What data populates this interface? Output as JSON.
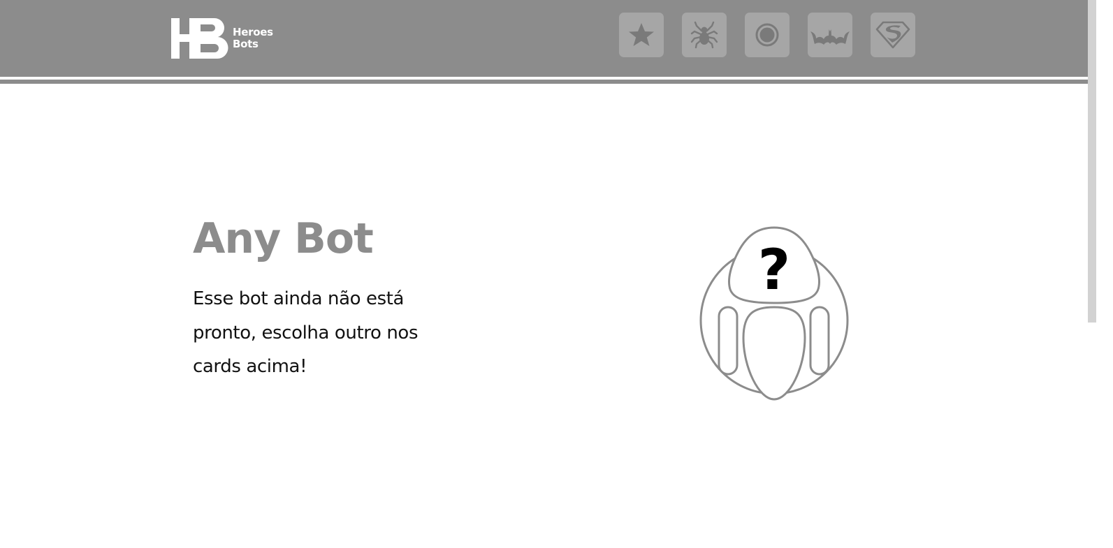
{
  "brand": {
    "logo_mark": "HB",
    "name_line1": "Heroes",
    "name_line2": "Bots"
  },
  "nav": {
    "items": [
      {
        "icon": "star-icon"
      },
      {
        "icon": "spider-icon"
      },
      {
        "icon": "target-circle-icon"
      },
      {
        "icon": "bat-icon"
      },
      {
        "icon": "superman-shield-icon"
      }
    ]
  },
  "main": {
    "title": "Any Bot",
    "description": "Esse bot ainda não está pronto, escolha outro nos cards acima!",
    "illustration": {
      "icon": "unknown-bot-icon",
      "mark": "?"
    }
  },
  "colors": {
    "header_bg": "#8c8c8c",
    "nav_button_bg": "#a6a6a6",
    "icon_color": "#7a7a7a",
    "title_color": "#8c8c8c",
    "text_color": "#111111"
  }
}
